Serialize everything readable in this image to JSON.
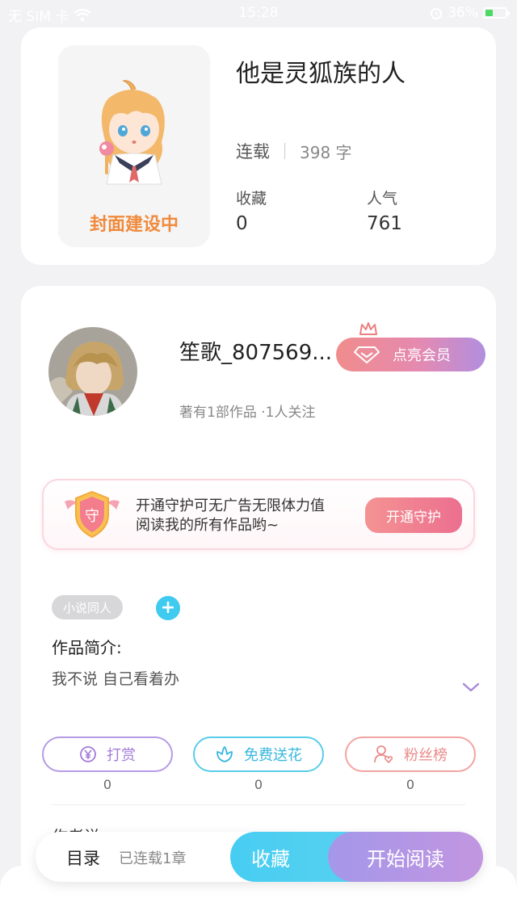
{
  "status_bar": {
    "carrier": "无 SIM 卡",
    "time": "15:28",
    "battery": "36%",
    "battery_level": 0.36
  },
  "book": {
    "title": "他是灵狐族的人",
    "cover_caption": "封面建设中",
    "serial_status": "连载",
    "word_count": "398 字",
    "stats": [
      {
        "label": "收藏",
        "value": "0"
      },
      {
        "label": "人气",
        "value": "761"
      }
    ]
  },
  "author": {
    "name": "笙歌_807569...",
    "vip_label": "点亮会员",
    "meta": "著有1部作品 ·1人关注"
  },
  "guard": {
    "badge": "守",
    "line1": "开通守护可无广告无限体力值",
    "line2": "阅读我的所有作品哟~",
    "button": "开通守护"
  },
  "tags": {
    "items": [
      "小说同人"
    ],
    "add": "+"
  },
  "intro": {
    "title": "作品简介:",
    "text": "我不说 自己看着办"
  },
  "actions": [
    {
      "label": "打赏",
      "icon": "yen-icon",
      "count": "0",
      "color": "#a47ad8"
    },
    {
      "label": "免费送花",
      "icon": "flower-icon",
      "count": "0",
      "color": "#36b7de"
    },
    {
      "label": "粉丝榜",
      "icon": "fans-icon",
      "count": "0",
      "color": "#ec8a8a"
    }
  ],
  "peek_text": "作者说",
  "bottom_bar": {
    "toc": "目录",
    "chapters": "已连载1章",
    "collect": "收藏",
    "read": "开始阅读"
  }
}
